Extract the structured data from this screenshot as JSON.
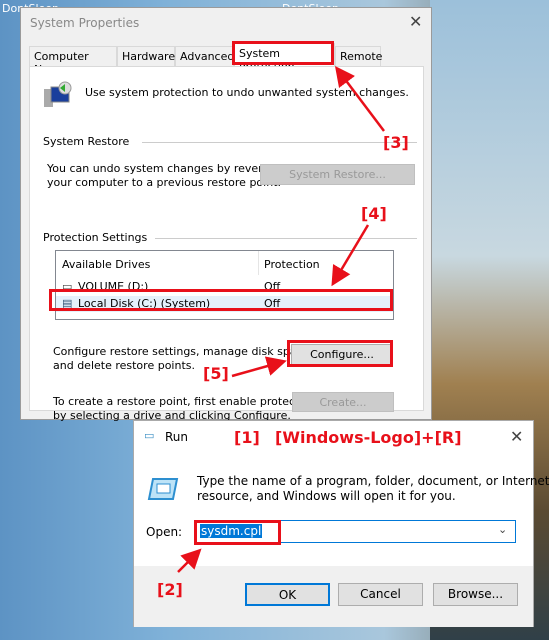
{
  "system_properties": {
    "title": "System Properties",
    "tabs": [
      "Computer Name",
      "Hardware",
      "Advanced",
      "System Protection",
      "Remote"
    ],
    "selected_tab": "System Protection",
    "intro": "Use system protection to undo unwanted system changes.",
    "system_restore": {
      "heading": "System Restore",
      "text1": "You can undo system changes by reverting",
      "text2": "your computer to a previous restore point.",
      "button": "System Restore..."
    },
    "protection": {
      "heading": "Protection Settings",
      "columns": [
        "Available Drives",
        "Protection"
      ],
      "rows": [
        {
          "drive": "VOLUME (D:)",
          "protection": "Off"
        },
        {
          "drive": "Local Disk (C:) (System)",
          "protection": "Off"
        }
      ],
      "configure_text1": "Configure restore settings, manage disk space,",
      "configure_text2": "and delete restore points.",
      "configure_button": "Configure...",
      "create_text1": "To create a restore point, first enable protection",
      "create_text2": "by selecting a drive and clicking Configure.",
      "create_button": "Create..."
    }
  },
  "run": {
    "title": "Run",
    "description1": "Type the name of a program, folder, document, or Internet",
    "description2": "resource, and Windows will open it for you.",
    "open_label": "Open:",
    "open_value": "sysdm.cpl",
    "ok": "OK",
    "cancel": "Cancel",
    "browse": "Browse..."
  },
  "annotations": {
    "step1": "[1]",
    "shortcut": "[Windows-Logo]+[R]",
    "step2": "[2]",
    "step3": "[3]",
    "step4": "[4]",
    "step5": "[5]"
  },
  "desktop_labels": [
    "DontSleep",
    "DontSleep"
  ],
  "colors": {
    "annotation_red": "#e8101a",
    "selection_blue": "#0078d7"
  }
}
